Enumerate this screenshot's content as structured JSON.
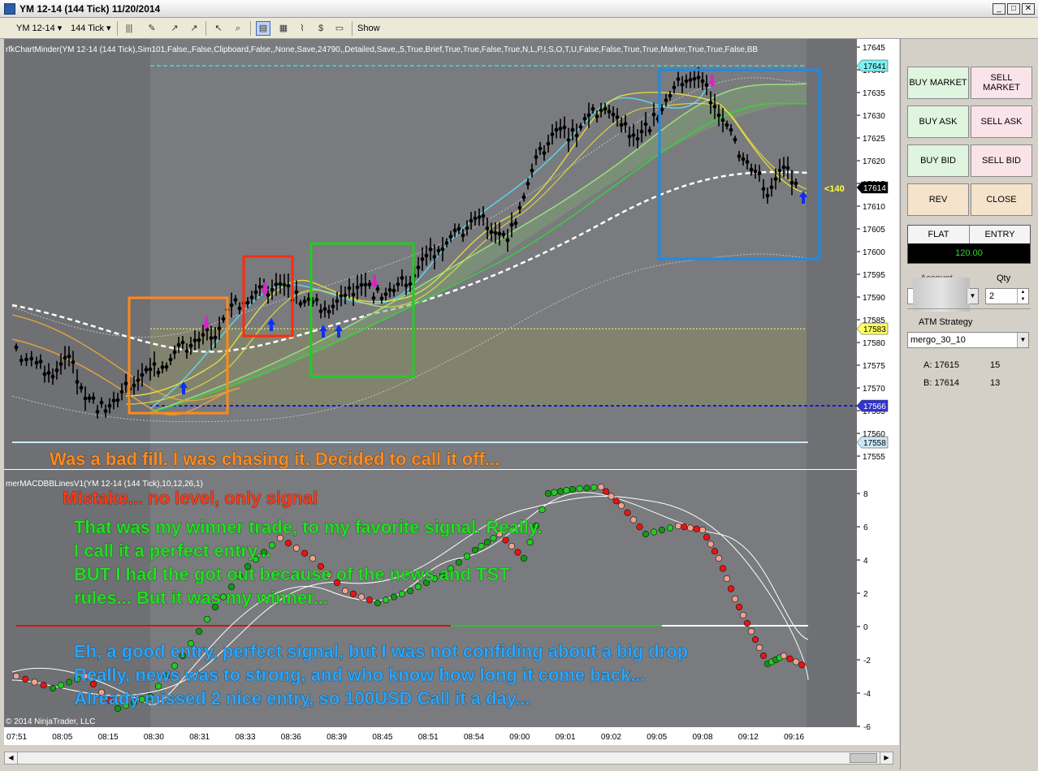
{
  "window": {
    "title": "YM 12-14 (144 Tick)  11/20/2014"
  },
  "toolbar": {
    "instrument": "YM 12-14",
    "interval": "144 Tick",
    "show_label": "Show"
  },
  "chart": {
    "indicator_top": "rfkChartMinder(YM 12-14 (144 Tick),Sim101,False,,False,Clipboard,False,,None,Save,24790,,Detailed,Save,,5,True,Brief,True,True,False,True,N,L,P,I,S,O,T,U,False,False,True,True,Marker,True,True,False,BB",
    "indicator_bottom": "merMACDBBLinesV1(YM 12-14 (144 Tick),10,12,26,1)",
    "copyright": "© 2014 NinjaTrader, LLC",
    "price_labels": [
      "17645",
      "17640",
      "17635",
      "17630",
      "17625",
      "17620",
      "17615",
      "17610",
      "17605",
      "17600",
      "17595",
      "17590",
      "17585",
      "17580",
      "17575",
      "17570",
      "17565",
      "17560",
      "17555"
    ],
    "price_flags": [
      {
        "value": "17641",
        "color": "#7ff0f0"
      },
      {
        "value": "17614",
        "color": "#000000"
      },
      {
        "value": "17583",
        "color": "#ffff66"
      },
      {
        "value": "17566",
        "color": "#3333cc"
      },
      {
        "value": "17558",
        "color": "#cde8f6"
      }
    ],
    "last_price_note": "<140",
    "macd_labels": [
      "8",
      "6",
      "4",
      "2",
      "0",
      "-2",
      "-4",
      "-6"
    ],
    "time_labels": [
      "07:51",
      "08:05",
      "08:15",
      "08:30",
      "08:31",
      "08:33",
      "08:36",
      "08:39",
      "08:45",
      "08:51",
      "08:54",
      "09:00",
      "09:01",
      "09:02",
      "09:05",
      "09:08",
      "09:12",
      "09:16"
    ],
    "annotations": {
      "bad_fill": "Was a bad fill. I was chasing it. Decided to call it off...",
      "mistake": "Mistake... no level, only signal",
      "winner_1": "That was my winner trade, to my favorite signal. Really.",
      "winner_2": "I call it a perfect entry...",
      "winner_3": "BUT I had the got out because of the news and TST",
      "winner_4": "rules... But it was my winner...",
      "good_1": "Eh, a good entry, perfect signal, but I was not confiding about a big drop",
      "good_2": "Really, news was to strong, and who know how long it come back...",
      "good_3": "Already missed 2 nice entry, so 100USD Call it a day..."
    }
  },
  "panel": {
    "buy_market": "BUY MARKET",
    "sell_market": "SELL MARKET",
    "buy_ask": "BUY ASK",
    "sell_ask": "SELL ASK",
    "buy_bid": "BUY BID",
    "sell_bid": "SELL BID",
    "rev": "REV",
    "close": "CLOSE",
    "flat": "FLAT",
    "entry": "ENTRY",
    "entry_value": "120.00",
    "account_label": "Account",
    "qty_label": "Qty",
    "qty_value": "2",
    "atm_label": "ATM Strategy",
    "atm_value": "mergo_30_10",
    "ask_label": "A: 17615",
    "ask_size": "15",
    "bid_label": "B: 17614",
    "bid_size": "13"
  }
}
